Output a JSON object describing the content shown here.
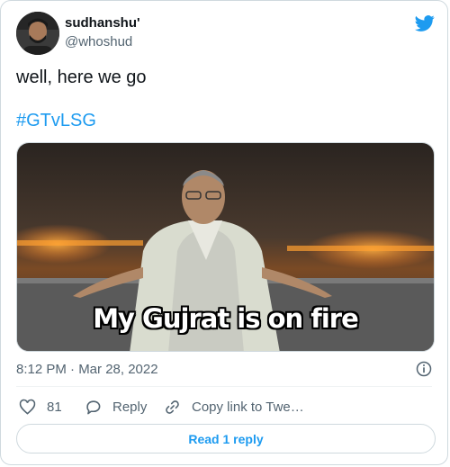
{
  "author": {
    "display_name": "sudhanshu'",
    "handle": "@whoshud"
  },
  "tweet": {
    "text": "well, here we go",
    "hashtag": "#GTvLSG",
    "timestamp": "8:12 PM · Mar 28, 2022"
  },
  "media": {
    "caption": "My Gujrat is on fire"
  },
  "actions": {
    "like_count": "81",
    "reply_label": "Reply",
    "copy_label": "Copy link to Twe…"
  },
  "footer": {
    "read_replies": "Read 1 reply"
  },
  "colors": {
    "accent": "#1d9bf0",
    "secondary_text": "#536471",
    "border": "#cfd9de"
  },
  "icons": [
    "twitter-bird-icon",
    "info-icon",
    "heart-icon",
    "reply-icon",
    "link-icon"
  ]
}
